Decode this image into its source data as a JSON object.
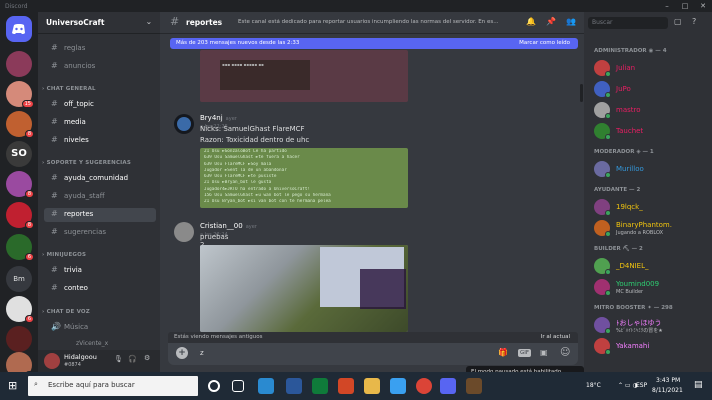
{
  "app": {
    "title": "Discord",
    "win": {
      "min": "–",
      "max": "□",
      "close": "✕"
    }
  },
  "server": {
    "name": "UniversoCraft",
    "chevron": "⌄"
  },
  "guild_badges": [
    "15",
    "8",
    "8",
    "8",
    "6",
    "6",
    "8"
  ],
  "guild_home_letters": "Bm",
  "channels": {
    "top": [
      {
        "name": "reglas"
      },
      {
        "name": "anuncios"
      }
    ],
    "cat_general": "CHAT GENERAL",
    "general": [
      {
        "name": "off_topic"
      },
      {
        "name": "media"
      },
      {
        "name": "niveles"
      }
    ],
    "cat_soporte": "SOPORTE Y SUGERENCIAS",
    "soporte": [
      {
        "name": "ayuda_comunidad"
      },
      {
        "name": "ayuda_staff"
      },
      {
        "name": "reportes"
      },
      {
        "name": "sugerencias"
      }
    ],
    "cat_mini": "MINIJUEGOS",
    "mini": [
      {
        "name": "trivia"
      },
      {
        "name": "conteo"
      }
    ],
    "cat_voz": "CHAT DE VOZ",
    "voice": {
      "name": "Música",
      "member": "zVicente_x"
    }
  },
  "user": {
    "name": "Hidalgoou",
    "tag": "#0874"
  },
  "channel": {
    "name": "reportes",
    "topic": "Este canal está dedicado para reportar usuarios incumpliendo las normas del servidor. En es..."
  },
  "search": {
    "placeholder": "Buscar"
  },
  "banner": {
    "text": "Más de 203 mensajes nuevos desde las 2:33",
    "action": "Marcar como leído"
  },
  "messages": [
    {
      "author": "Bry4nj",
      "time": "ayer a las 22:26",
      "lines": [
        "Nicks: SamuelGhast FlareMCF",
        "Razon: Toxicidad dentro de uhc"
      ]
    },
    {
      "author": "Cristian__00",
      "time": "ayer a las 22:24",
      "lines": [
        "pruebas 2"
      ]
    }
  ],
  "chatlog": [
    "21  Usu ►GonzaloBot Le ha partido",
    "639 Usu SamuelGhast ►te fuera a hacer",
    "639 Usu FlareMCF ►Soy mala",
    "Jugador ►Sent la de un abandonar",
    "639 Usu FlareMCF ►te pusiste",
    "21  Usu ►Bryan_bot le gusta",
    "Jugador4►JRTO ha entrado a UniversoCraft!",
    "156 Usu SamuelGhast ►u wan bot le pego su hermana",
    "21  Usu Bryan_bot ►si van bot con te hermana pelea"
  ],
  "statusbar": {
    "left": "Estás viendo mensajes antiguos",
    "right": "Ir al actual"
  },
  "composer": {
    "value": "z",
    "plus": "+",
    "gift": "🎁",
    "gif": "GIF",
    "sticker": "▣",
    "emoji": "☺"
  },
  "members": {
    "groups": [
      {
        "title": "ADMINISTRADOR ◉ — 4",
        "items": [
          {
            "name": "Julian",
            "color": "#e91e63"
          },
          {
            "name": "JuPo",
            "color": "#e91e63"
          },
          {
            "name": "mastro",
            "color": "#e91e63"
          },
          {
            "name": "Tauchet",
            "color": "#e91e63"
          }
        ]
      },
      {
        "title": "MODERADOR ◈ — 1",
        "items": [
          {
            "name": "Murilloo",
            "color": "#3498db"
          }
        ]
      },
      {
        "title": "AYUDANTE — 2",
        "items": [
          {
            "name": "19lqck_",
            "color": "#f1c40f"
          },
          {
            "name": "BinaryPhantom.",
            "color": "#f1c40f",
            "sub": "Jugando a ROBLOX"
          }
        ]
      },
      {
        "title": "BUILDER ⛏ — 2",
        "items": [
          {
            "name": "_D4NIEL_",
            "color": "#f1c40f"
          },
          {
            "name": "Youmind009",
            "color": "#2ecc71",
            "sub": "MC Builder"
          }
        ]
      },
      {
        "title": "MITRO BOOSTER ✦ — 298",
        "items": [
          {
            "name": "ﾄおしゃほゆう",
            "color": "#f47fff",
            "sub": "%ﾋﾞﾊｲﾄﾐﾍﾐｸの冒を★"
          },
          {
            "name": "Yakamahi",
            "color": "#f47fff"
          }
        ]
      }
    ]
  },
  "toast": "El modo pausado está habilitado.",
  "taskbar": {
    "search": "Escribe aquí para buscar",
    "temp": "18°C",
    "lang": "ESP",
    "time": "3:43 PM",
    "date": "8/11/2021"
  },
  "colors": {
    "accent": "#5865f2",
    "bg": "#36393f"
  }
}
